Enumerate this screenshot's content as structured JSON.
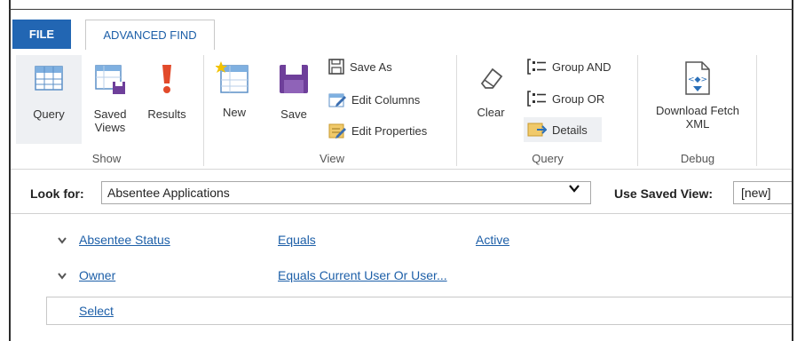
{
  "tabs": {
    "file": "FILE",
    "advanced_find": "ADVANCED FIND"
  },
  "ribbon": {
    "show": {
      "group_label": "Show",
      "query": "Query",
      "saved_views_1": "Saved",
      "saved_views_2": "Views",
      "results": "Results"
    },
    "view": {
      "group_label": "View",
      "new": "New",
      "save": "Save",
      "save_as": "Save As",
      "edit_columns": "Edit Columns",
      "edit_properties": "Edit Properties"
    },
    "query": {
      "group_label": "Query",
      "clear": "Clear",
      "group_and": "Group AND",
      "group_or": "Group OR",
      "details": "Details"
    },
    "debug": {
      "group_label": "Debug",
      "download_1": "Download Fetch",
      "download_2": "XML"
    }
  },
  "lookfor": {
    "label": "Look for:",
    "value": "Absentee Applications",
    "saved_view_label": "Use Saved View:",
    "saved_view_value": "[new]"
  },
  "conditions": [
    {
      "field": "Absentee Status",
      "operator": "Equals",
      "value": "Active"
    },
    {
      "field": "Owner",
      "operator": "Equals Current User Or User...",
      "value": ""
    }
  ],
  "select_label": "Select",
  "colors": {
    "accent": "#2266b3",
    "link": "#1d5fa8"
  }
}
